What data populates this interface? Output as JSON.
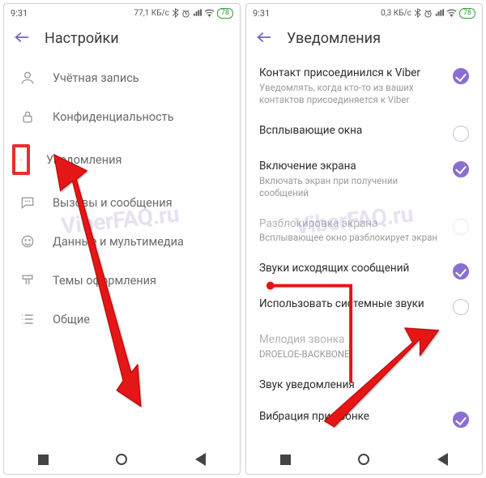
{
  "status": {
    "time": "9:31",
    "net_left": "77,1 КБ/с",
    "net_right": "0,3 КБ/с",
    "battery": "78"
  },
  "left": {
    "title": "Настройки",
    "items": [
      {
        "label": "Учётная запись",
        "icon": "person-icon"
      },
      {
        "label": "Конфиденциальность",
        "icon": "lock-icon"
      },
      {
        "label": "Уведомления",
        "icon": "bell-icon"
      },
      {
        "label": "Вызовы и сообщения",
        "icon": "chat-icon"
      },
      {
        "label": "Данные и мультимедиа",
        "icon": "media-icon"
      },
      {
        "label": "Темы оформления",
        "icon": "brush-icon"
      },
      {
        "label": "Общие",
        "icon": "list-icon"
      }
    ]
  },
  "right": {
    "title": "Уведомления",
    "settings": [
      {
        "title": "Контакт присоединился к Viber",
        "sub": "Уведомлять, когда кто-то из ваших контактов присоединяется к Viber",
        "on": true
      },
      {
        "title": "Всплывающие окна",
        "sub": "",
        "on": false
      },
      {
        "title": "Включение экрана",
        "sub": "Включать экран при получении сообщений",
        "on": true
      },
      {
        "title": "Разблокировка экрана",
        "sub": "Всплывающее окно разблокирует экран",
        "on": false,
        "disabled": true
      },
      {
        "title": "Звуки исходящих сообщений",
        "sub": "",
        "on": true
      },
      {
        "title": "Использовать системные звуки",
        "sub": "",
        "on": false
      },
      {
        "title": "Мелодия звонка",
        "sub": "DROELOE-BACKBONE",
        "on": null,
        "disabled": true
      },
      {
        "title": "Звук уведомления",
        "sub": "",
        "on": null
      },
      {
        "title": "Вибрация при звонке",
        "sub": "",
        "on": true
      }
    ]
  },
  "watermark": "ViberFAQ.ru"
}
